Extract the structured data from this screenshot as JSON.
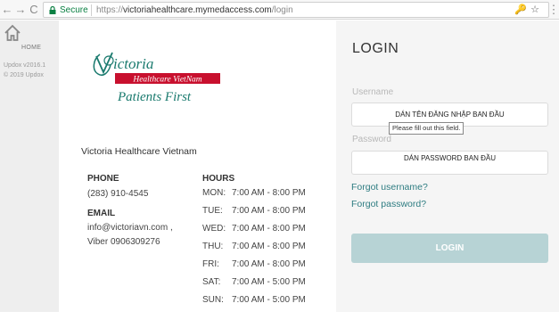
{
  "browser": {
    "back": "←",
    "forward": "→",
    "reload": "C",
    "secure_label": "Secure",
    "url_scheme": "https://",
    "url_host": "victoriahealthcare.mymedaccess.com",
    "url_path": "/login",
    "key_icon": "🔑",
    "star_icon": "☆",
    "menu_icon": "⋮"
  },
  "sidebar": {
    "home_label": "HOME",
    "version": "Updox v2016.1",
    "copyright": "© 2019 Updox"
  },
  "brand": {
    "logo_word": "ictoria",
    "logo_band": "Healthcare VietNam",
    "logo_tagline": "Patients First",
    "band_color": "#c8102e",
    "accent_color": "#1a7a6e"
  },
  "contact": {
    "org_name": "Victoria Healthcare Vietnam",
    "phone_heading": "PHONE",
    "phone": "(283) 910-4545",
    "email_heading": "EMAIL",
    "email_line1": "info@victoriavn.com ,",
    "email_line2": "Viber 0906309276",
    "hours_heading": "HOURS",
    "hours": [
      {
        "day": "MON:",
        "time": "7:00 AM - 8:00 PM"
      },
      {
        "day": "TUE:",
        "time": "7:00 AM - 8:00 PM"
      },
      {
        "day": "WED:",
        "time": "7:00 AM - 8:00 PM"
      },
      {
        "day": "THU:",
        "time": "7:00 AM - 8:00 PM"
      },
      {
        "day": "FRI:",
        "time": "7:00 AM - 8:00 PM"
      },
      {
        "day": "SAT:",
        "time": "7:00 AM - 5:00 PM"
      },
      {
        "day": "SUN:",
        "time": "7:00 AM - 5:00 PM"
      }
    ]
  },
  "login": {
    "title": "LOGIN",
    "username_label": "Username",
    "username_value": "DÁN TÊN ĐĂNG NHẬP BAN ĐẦU",
    "tooltip": "Please fill out this field.",
    "password_label": "Password",
    "password_value": "DÁN PASSWORD BAN ĐẦU",
    "forgot_username": "Forgot username?",
    "forgot_password": "Forgot password?",
    "login_button": "LOGIN",
    "button_color": "#b7d3d5",
    "link_color": "#2f7d82"
  }
}
